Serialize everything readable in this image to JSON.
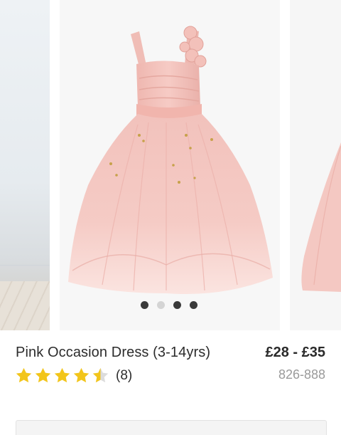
{
  "carousel": {
    "dot_count": 4,
    "active_dot": 2,
    "colors": {
      "dress": "#f4c4bf",
      "dress_shadow": "#e9aea8",
      "background": "#f7f7f7"
    }
  },
  "product": {
    "title": "Pink Occasion Dress (3-14yrs)",
    "price": "£28 - £35",
    "sku": "826-888",
    "rating": 4.5,
    "review_count": "(8)",
    "star_color": "#f2c51b"
  }
}
